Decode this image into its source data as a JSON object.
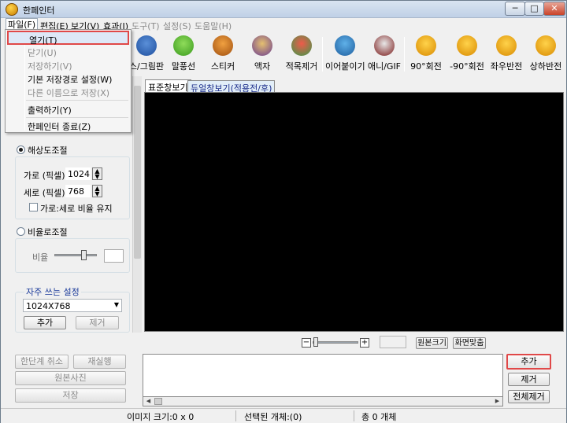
{
  "window": {
    "title": "한페인터",
    "minimize": "─",
    "maximize": "□",
    "close": "✕"
  },
  "menubar": {
    "items": [
      {
        "label": "파일(F)"
      },
      {
        "label": "편집(E)"
      },
      {
        "label": "보기(V)"
      },
      {
        "label": "효과(I)"
      },
      {
        "label": "도구(T)"
      },
      {
        "label": "설정(S)"
      },
      {
        "label": "도움말(H)"
      }
    ]
  },
  "file_menu": {
    "items": [
      {
        "label": "열기(T)"
      },
      {
        "label": "닫기(U)"
      },
      {
        "label": "저장하기(V)"
      },
      {
        "label": "기본 저장경로 설정(W)"
      },
      {
        "label": "다른 이름으로 저장(X)"
      },
      {
        "label": "출력하기(Y)"
      },
      {
        "label": "한페인터 종료(Z)"
      }
    ]
  },
  "toolbar": {
    "items": [
      {
        "label": "스/그림판",
        "icon": "sketch-icon"
      },
      {
        "label": "말풍선",
        "icon": "speech-bubble-icon"
      },
      {
        "label": "스티커",
        "icon": "sticker-icon"
      },
      {
        "label": "액자",
        "icon": "frame-icon"
      },
      {
        "label": "적목제거",
        "icon": "red-eye-icon"
      },
      {
        "label": "이어붙이기",
        "icon": "merge-icon"
      },
      {
        "label": "애니/GIF",
        "icon": "animation-icon"
      },
      {
        "label": "90°회전",
        "icon": "rotate-right-icon"
      },
      {
        "label": "-90°회전",
        "icon": "rotate-left-icon"
      },
      {
        "label": "좌우반전",
        "icon": "flip-horizontal-icon"
      },
      {
        "label": "상하반전",
        "icon": "flip-vertical-icon"
      }
    ]
  },
  "left_panel": {
    "resolution_label": "해상도조절",
    "width_label": "가로 (픽셀)",
    "width_value": "1024",
    "height_label": "세로 (픽셀)",
    "height_value": "768",
    "keep_ratio_label": "가로:세로 비율 유지",
    "ratio_adjust_label": "비율로조절",
    "ratio_label": "비율",
    "presets_label": "자주 쓰는 설정",
    "preset_value": "1024X768",
    "add_label": "추가",
    "remove_label": "제거"
  },
  "bottom_left": {
    "undo_label": "한단계 취소",
    "redo_label": "재실행",
    "original_label": "원본사진",
    "save_label": "저장"
  },
  "tabs": {
    "standard": "표준창보기",
    "dual": "듀얼창보기(적용전/후)"
  },
  "zoom": {
    "minus": "−",
    "plus": "+",
    "original_size": "원본크기",
    "fit_screen": "화면맞춤"
  },
  "file_actions": {
    "add": "추가",
    "remove": "제거",
    "remove_all": "전체제거"
  },
  "statusbar": {
    "image_size": "이미지 크기:0 x 0",
    "selected": "선택된 개체:(0)",
    "total": "총 0 개체"
  },
  "colors": {
    "highlight": "#e04848",
    "canvas": "#000000",
    "link_blue": "#1a3a9a"
  }
}
